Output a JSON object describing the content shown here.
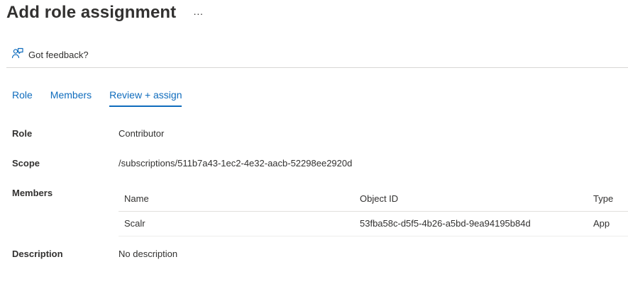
{
  "page": {
    "title": "Add role assignment",
    "more_label": "···"
  },
  "toolbar": {
    "feedback_label": "Got feedback?",
    "feedback_icon": "feedback-person-icon"
  },
  "tabs": [
    {
      "label": "Role",
      "active": false
    },
    {
      "label": "Members",
      "active": false
    },
    {
      "label": "Review + assign",
      "active": true
    }
  ],
  "review": {
    "role_label": "Role",
    "role_value": "Contributor",
    "scope_label": "Scope",
    "scope_value": "/subscriptions/511b7a43-1ec2-4e32-aacb-52298ee2920d",
    "members_label": "Members",
    "members_table": {
      "columns": [
        "Name",
        "Object ID",
        "Type"
      ],
      "rows": [
        {
          "name": "Scalr",
          "object_id": "53fba58c-d5f5-4b26-a5bd-9ea94195b84d",
          "type": "App"
        }
      ]
    },
    "description_label": "Description",
    "description_value": "No description"
  },
  "colors": {
    "accent": "#0f6cbd",
    "text": "#323130",
    "divider": "#d8d6d4"
  }
}
